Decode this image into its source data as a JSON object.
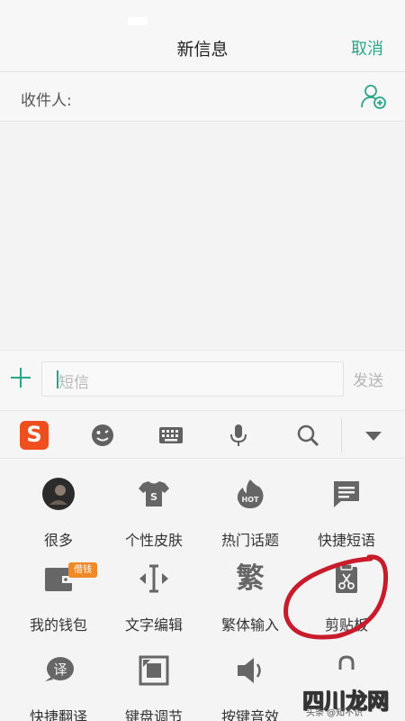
{
  "header": {
    "title": "新信息",
    "cancel_label": "取消"
  },
  "recipient": {
    "label": "收件人:"
  },
  "composer": {
    "placeholder": "短信",
    "send_label": "发送"
  },
  "toolbar": {
    "logo": "S"
  },
  "panel": {
    "badge": "借钱",
    "items": [
      {
        "label": "很多",
        "icon": "avatar"
      },
      {
        "label": "个性皮肤",
        "icon": "shirt-icon"
      },
      {
        "label": "热门话题",
        "icon": "hot-flame-icon"
      },
      {
        "label": "快捷短语",
        "icon": "message-icon"
      },
      {
        "label": "我的钱包",
        "icon": "wallet-icon"
      },
      {
        "label": "文字编辑",
        "icon": "text-cursor-icon"
      },
      {
        "label": "繁体输入",
        "icon": "traditional-char-icon",
        "glyph": "繁"
      },
      {
        "label": "剪贴板",
        "icon": "clipboard-icon"
      },
      {
        "label": "快捷翻译",
        "icon": "translate-icon",
        "glyph": "译"
      },
      {
        "label": "键盘调节",
        "icon": "keyboard-resize-icon"
      },
      {
        "label": "按键音效",
        "icon": "speaker-icon"
      },
      {
        "label": "",
        "icon": "lock-icon"
      }
    ]
  },
  "watermark": {
    "big": "四川龙网",
    "small": "头条 @知不识"
  },
  "colors": {
    "accent": "#2aa58a",
    "sogou": "#f04e1e",
    "badge": "#f08a28",
    "annotation": "#c81b2c"
  }
}
